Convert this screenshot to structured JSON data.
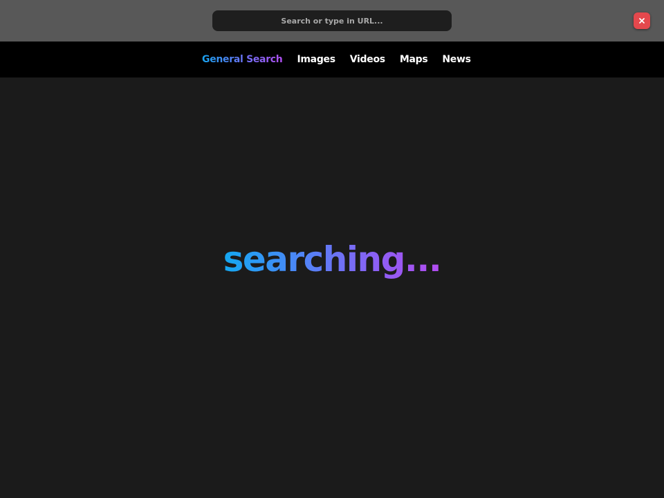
{
  "browser": {
    "url_placeholder": "Search or type in URL...",
    "close_icon": "close-icon",
    "close_color": "#e5484d"
  },
  "nav": {
    "items": [
      {
        "label": "General Search",
        "active": true
      },
      {
        "label": "Images",
        "active": false
      },
      {
        "label": "Videos",
        "active": false
      },
      {
        "label": "Maps",
        "active": false
      },
      {
        "label": "News",
        "active": false
      }
    ],
    "accent_gradient": [
      "#17a3f0",
      "#b04ff2"
    ]
  },
  "main": {
    "status_text": "searching..."
  }
}
